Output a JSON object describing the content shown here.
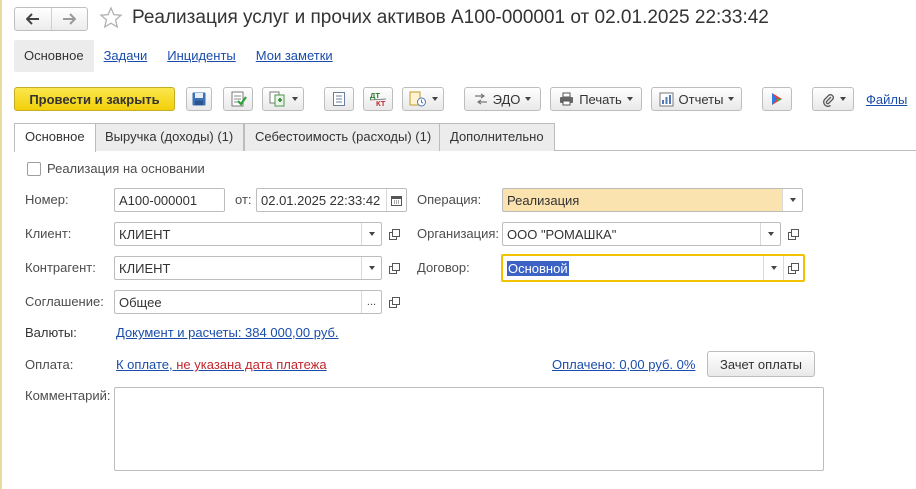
{
  "window": {
    "title": "Реализация услуг и прочих активов А100-000001 от 02.01.2025 22:33:42"
  },
  "subnav": {
    "items": [
      {
        "label": "Основное"
      },
      {
        "label": "Задачи"
      },
      {
        "label": "Инциденты"
      },
      {
        "label": "Мои заметки"
      }
    ]
  },
  "toolbar": {
    "post_and_close": "Провести и закрыть",
    "edo": "ЭДО",
    "print": "Печать",
    "reports": "Отчеты",
    "files": "Файлы",
    "dt_top": "ДТ",
    "kt_bottom": "КТ"
  },
  "tabs": [
    {
      "label": "Основное"
    },
    {
      "label": "Выручка (доходы) (1)"
    },
    {
      "label": "Себестоимость (расходы) (1)"
    },
    {
      "label": "Дополнительно"
    }
  ],
  "form": {
    "based_on_label": "Реализация на основании",
    "number_label": "Номер:",
    "number_value": "А100-000001",
    "date_label": "от:",
    "date_value": "02.01.2025 22:33:42",
    "client_label": "Клиент:",
    "client_value": "КЛИЕНТ",
    "counterparty_label": "Контрагент:",
    "counterparty_value": "КЛИЕНТ",
    "agreement_label": "Соглашение:",
    "agreement_value": "Общее",
    "agreement_select": "...",
    "operation_label": "Операция:",
    "operation_value": "Реализация",
    "organization_label": "Организация:",
    "organization_value": "ООО \"РОМАШКА\"",
    "contract_label": "Договор:",
    "contract_value": "Основной",
    "currencies_label": "Валюты:",
    "currencies_link": "Документ и расчеты: 384 000,00 руб.",
    "payment_label": "Оплата:",
    "payment_link_prefix": "К оплате, ",
    "payment_link_warning": "не указана дата платежа",
    "paid_link": "Оплачено: 0,00 руб. 0%",
    "offset_button": "Зачет оплаты",
    "comment_label": "Комментарий:",
    "comment_value": ""
  },
  "colors": {
    "primary_button": "#f5d31c",
    "operation_bg": "#fbe3b0",
    "link": "#1a4dab",
    "warning": "#c0272d",
    "focus_border": "#f2c200",
    "selection": "#3d62c5"
  },
  "icons": [
    "back-arrow-icon",
    "forward-arrow-icon",
    "star-icon",
    "save-icon",
    "post-icon",
    "create-based-on-icon",
    "list-icon",
    "dt-kt-icon",
    "document-structure-icon",
    "edo-icon",
    "printer-icon",
    "reports-icon",
    "run-icon",
    "paperclip-icon",
    "calendar-icon",
    "open-icon",
    "dropdown-icon"
  ]
}
